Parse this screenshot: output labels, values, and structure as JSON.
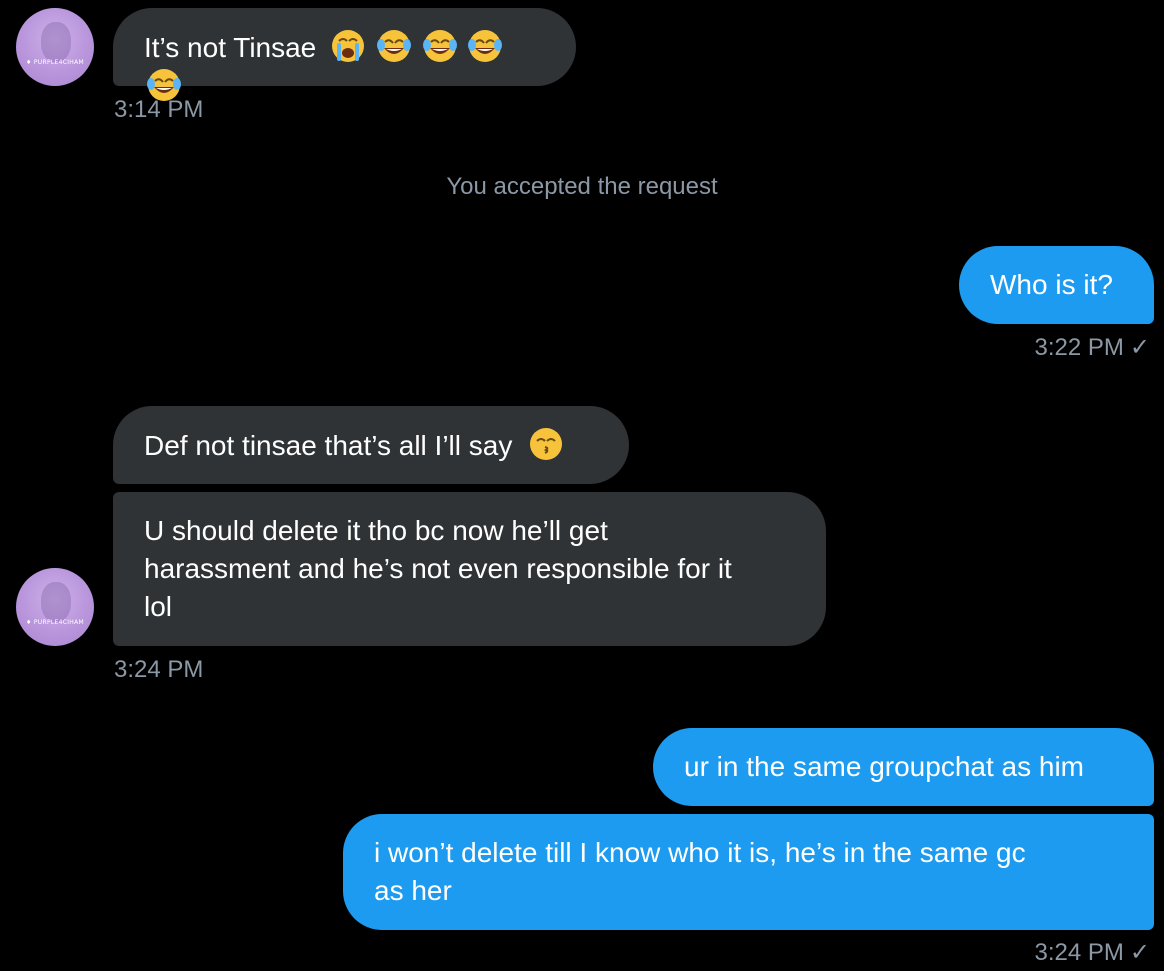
{
  "conversation": {
    "system_message": "You accepted the request",
    "messages": [
      {
        "direction": "incoming",
        "text": "It’s not Tinsae",
        "emoji": [
          "loudly-crying-face",
          "face-with-tears-of-joy",
          "face-with-tears-of-joy",
          "face-with-tears-of-joy",
          "face-with-tears-of-joy"
        ],
        "time": "3:14 PM"
      },
      {
        "direction": "outgoing",
        "text": "Who is it?",
        "time": "3:22 PM",
        "status": "✓"
      },
      {
        "direction": "incoming",
        "text": "Def not tinsae that’s all I’ll say",
        "emoji": [
          "kissing-face-with-smiling-eyes"
        ]
      },
      {
        "direction": "incoming",
        "text": "U should delete it tho bc now he’ll get\nharassment and he’s not even responsible for it\nlol",
        "time": "3:24 PM"
      },
      {
        "direction": "outgoing",
        "text": "ur in the same groupchat as him"
      },
      {
        "direction": "outgoing",
        "text": "i won’t delete till I know who it is, he’s in the same gc\nas her",
        "time": "3:24 PM",
        "status": "✓"
      }
    ]
  },
  "avatar": {
    "tag": "♦ PURPLE4CIHAM",
    "color": "#b995dc"
  },
  "colors": {
    "incoming_bubble": "#2f3336",
    "outgoing_bubble": "#1d9bf0",
    "timestamp": "#8b98a5",
    "background": "#000000"
  }
}
